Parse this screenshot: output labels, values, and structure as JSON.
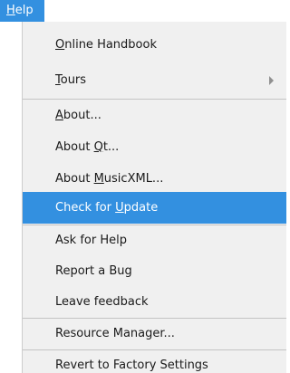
{
  "menubar": {
    "help": {
      "pre": "",
      "key": "H",
      "post": "elp"
    }
  },
  "menu": {
    "items": [
      {
        "pre": "",
        "key": "O",
        "post": "nline Handbook"
      },
      {
        "pre": "",
        "key": "T",
        "post": "ours"
      },
      {
        "pre": "",
        "key": "A",
        "post": "bout..."
      },
      {
        "pre": "About ",
        "key": "Q",
        "post": "t..."
      },
      {
        "pre": "About ",
        "key": "M",
        "post": "usicXML..."
      },
      {
        "pre": "Check for ",
        "key": "U",
        "post": "pdate"
      },
      {
        "pre": "Ask for Help",
        "key": "",
        "post": ""
      },
      {
        "pre": "Report a Bug",
        "key": "",
        "post": ""
      },
      {
        "pre": "Leave feedback",
        "key": "",
        "post": ""
      },
      {
        "pre": "Resource Manager...",
        "key": "",
        "post": ""
      },
      {
        "pre": "Revert to Factory Settings",
        "key": "",
        "post": ""
      }
    ],
    "highlighted_item": "Check for Update"
  },
  "colors": {
    "highlight": "#3390e0",
    "menu_background": "#f0f0f0"
  }
}
